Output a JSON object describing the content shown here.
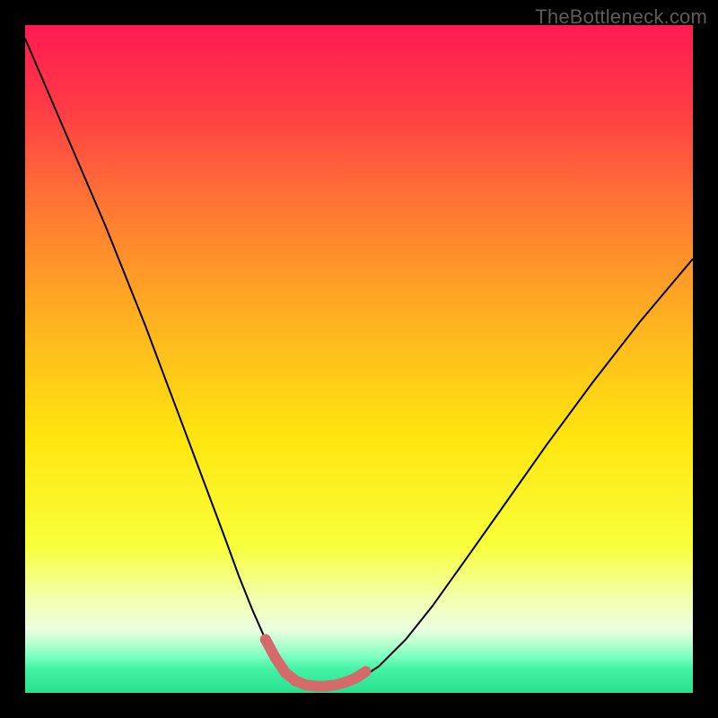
{
  "watermark": "TheBottleneck.com",
  "chart_data": {
    "type": "line",
    "title": "",
    "xlabel": "",
    "ylabel": "",
    "xlim": [
      0,
      100
    ],
    "ylim": [
      0,
      100
    ],
    "background_gradient_stops": [
      {
        "offset": 0.0,
        "color": "#ff1a52"
      },
      {
        "offset": 0.12,
        "color": "#ff3a46"
      },
      {
        "offset": 0.28,
        "color": "#ff7a33"
      },
      {
        "offset": 0.45,
        "color": "#ffb41f"
      },
      {
        "offset": 0.62,
        "color": "#ffe60f"
      },
      {
        "offset": 0.78,
        "color": "#f8ff3a"
      },
      {
        "offset": 0.86,
        "color": "#f2ffb0"
      },
      {
        "offset": 0.905,
        "color": "#ecffe0"
      },
      {
        "offset": 0.925,
        "color": "#b8ffd0"
      },
      {
        "offset": 0.945,
        "color": "#7effc0"
      },
      {
        "offset": 0.965,
        "color": "#42f2a5"
      },
      {
        "offset": 1.0,
        "color": "#29e08d"
      }
    ],
    "series": [
      {
        "name": "bottleneck-curve",
        "color": "#000000",
        "stroke_width": 2,
        "x": [
          0.0,
          3.0,
          6.0,
          9.0,
          12.0,
          15.0,
          18.0,
          21.0,
          24.0,
          27.0,
          30.0,
          32.0,
          34.0,
          36.0,
          37.5,
          39.0,
          40.5,
          42.0,
          44.0,
          46.0,
          48.0,
          50.0,
          53.0,
          57.0,
          61.0,
          66.0,
          72.0,
          78.0,
          85.0,
          92.0,
          100.0
        ],
        "y": [
          98.0,
          91.0,
          84.0,
          77.0,
          70.0,
          62.5,
          55.0,
          47.0,
          39.0,
          31.0,
          23.0,
          17.5,
          12.5,
          8.0,
          5.2,
          3.0,
          1.6,
          1.0,
          1.0,
          1.0,
          1.3,
          2.0,
          4.0,
          8.0,
          13.0,
          20.0,
          28.5,
          37.0,
          46.5,
          55.5,
          65.0
        ]
      },
      {
        "name": "marker-band",
        "type": "scatter",
        "color": "#d46a6a",
        "marker_radius": 6,
        "x": [
          36.0,
          37.5,
          39.0,
          40.5,
          42.0,
          43.5,
          45.0,
          46.5,
          48.0,
          49.5,
          51.0
        ],
        "y": [
          8.0,
          5.2,
          3.0,
          1.8,
          1.2,
          1.0,
          1.0,
          1.2,
          1.6,
          2.2,
          3.2
        ]
      }
    ]
  }
}
